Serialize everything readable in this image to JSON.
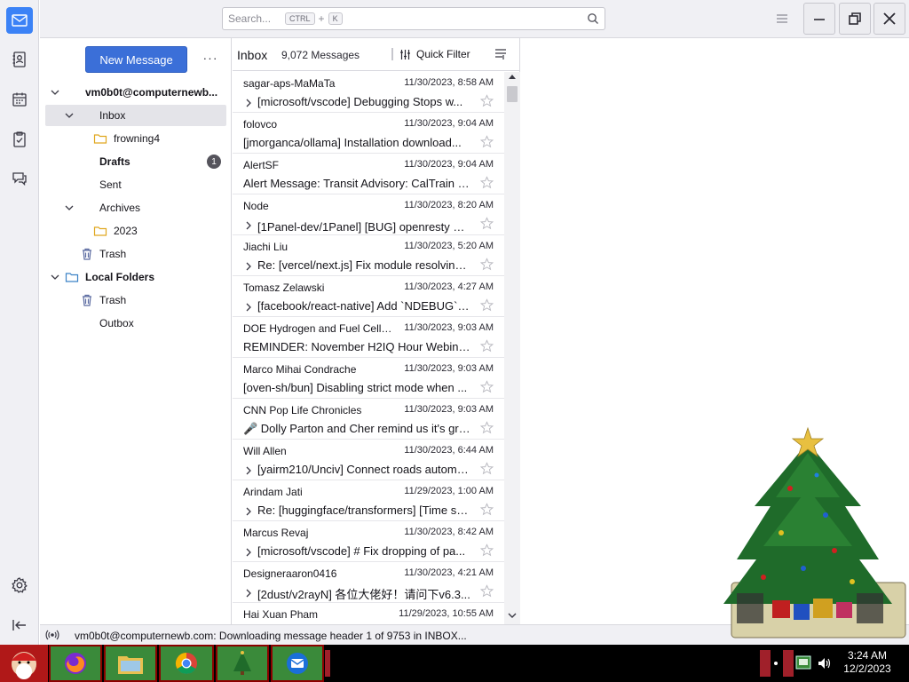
{
  "spaces": {
    "items": [
      {
        "name": "mail",
        "icon": "mail-icon",
        "active": true
      },
      {
        "name": "address-book",
        "icon": "address-book-icon",
        "active": false
      },
      {
        "name": "calendar",
        "icon": "calendar-icon",
        "active": false
      },
      {
        "name": "tasks",
        "icon": "tasks-icon",
        "active": false
      },
      {
        "name": "chat",
        "icon": "chat-icon",
        "active": false
      }
    ],
    "settings_icon": "gear-icon",
    "collapse_icon": "collapse-icon"
  },
  "header": {
    "search_placeholder": "Search...",
    "search_kbd_1": "CTRL",
    "search_kbd_plus": "+",
    "search_kbd_2": "K"
  },
  "folder_pane": {
    "new_message_label": "New Message",
    "more_label": "···",
    "account": "vm0b0t@computernewb...",
    "folders": [
      {
        "label": "Inbox",
        "selected": true
      },
      {
        "label": "frowning4"
      },
      {
        "label": "Drafts",
        "badge": "1"
      },
      {
        "label": "Sent"
      },
      {
        "label": "Archives"
      },
      {
        "label": "2023"
      },
      {
        "label": "Trash"
      }
    ],
    "local_folders": "Local Folders",
    "local": [
      {
        "label": "Trash"
      },
      {
        "label": "Outbox"
      }
    ]
  },
  "list_pane": {
    "title": "Inbox",
    "count": "9,072 Messages",
    "quick_filter": "Quick Filter",
    "messages": [
      {
        "from": "sagar-aps-MaMaTa",
        "date": "11/30/2023, 8:58 AM",
        "subject": "[microsoft/vscode] Debugging Stops w...",
        "thread": true
      },
      {
        "from": "folovco",
        "date": "11/30/2023, 9:04 AM",
        "subject": "[jmorganca/ollama] Installation download...",
        "thread": false
      },
      {
        "from": "AlertSF",
        "date": "11/30/2023, 9:04 AM",
        "subject": "Alert Message: Transit Advisory: CalTrain s...",
        "thread": false
      },
      {
        "from": "Node",
        "date": "11/30/2023, 8:20 AM",
        "subject": "[1Panel-dev/1Panel] [BUG] openresty 证...",
        "thread": true
      },
      {
        "from": "Jiachi Liu",
        "date": "11/30/2023, 5:20 AM",
        "subject": "Re: [vercel/next.js] Fix module resolving ...",
        "thread": true
      },
      {
        "from": "Tomasz Zelawski",
        "date": "11/30/2023, 4:27 AM",
        "subject": "[facebook/react-native] Add `NDEBUG` fl...",
        "thread": true
      },
      {
        "from": "DOE Hydrogen and Fuel Cell T...",
        "date": "11/30/2023, 9:03 AM",
        "subject": "REMINDER: November H2IQ Hour Webina...",
        "thread": false
      },
      {
        "from": "Marco Mihai Condrache",
        "date": "11/30/2023, 9:03 AM",
        "subject": "[oven-sh/bun] Disabling strict mode when ...",
        "thread": false
      },
      {
        "from": "CNN Pop Life Chronicles",
        "date": "11/30/2023, 9:03 AM",
        "subject": "🎤 Dolly Parton and Cher remind us it's gre...",
        "thread": false
      },
      {
        "from": "Will Allen",
        "date": "11/30/2023, 6:44 AM",
        "subject": "[yairm210/Unciv] Connect roads automa...",
        "thread": true
      },
      {
        "from": "Arindam Jati",
        "date": "11/29/2023, 1:00 AM",
        "subject": "Re: [huggingface/transformers] [Time se...",
        "thread": true
      },
      {
        "from": "Marcus Revaj",
        "date": "11/30/2023, 8:42 AM",
        "subject": "[microsoft/vscode] # Fix dropping of pa...",
        "thread": true
      },
      {
        "from": "Designeraaron0416",
        "date": "11/30/2023, 4:21 AM",
        "subject": "[2dust/v2rayN] 各位大佬好！请问下v6.3...",
        "thread": true
      },
      {
        "from": "Hai Xuan Pham",
        "date": "11/29/2023, 10:55 AM",
        "subject": "",
        "thread": false
      }
    ]
  },
  "status": {
    "text": "vm0b0t@computernewb.com: Downloading message header 1 of 9753 in INBOX..."
  },
  "taskbar": {
    "time": "3:24 AM",
    "date": "12/2/2023"
  },
  "colors": {
    "accent": "#3b6fd8",
    "folder_yellow": "#e8b020",
    "taskbar": "#000000"
  }
}
